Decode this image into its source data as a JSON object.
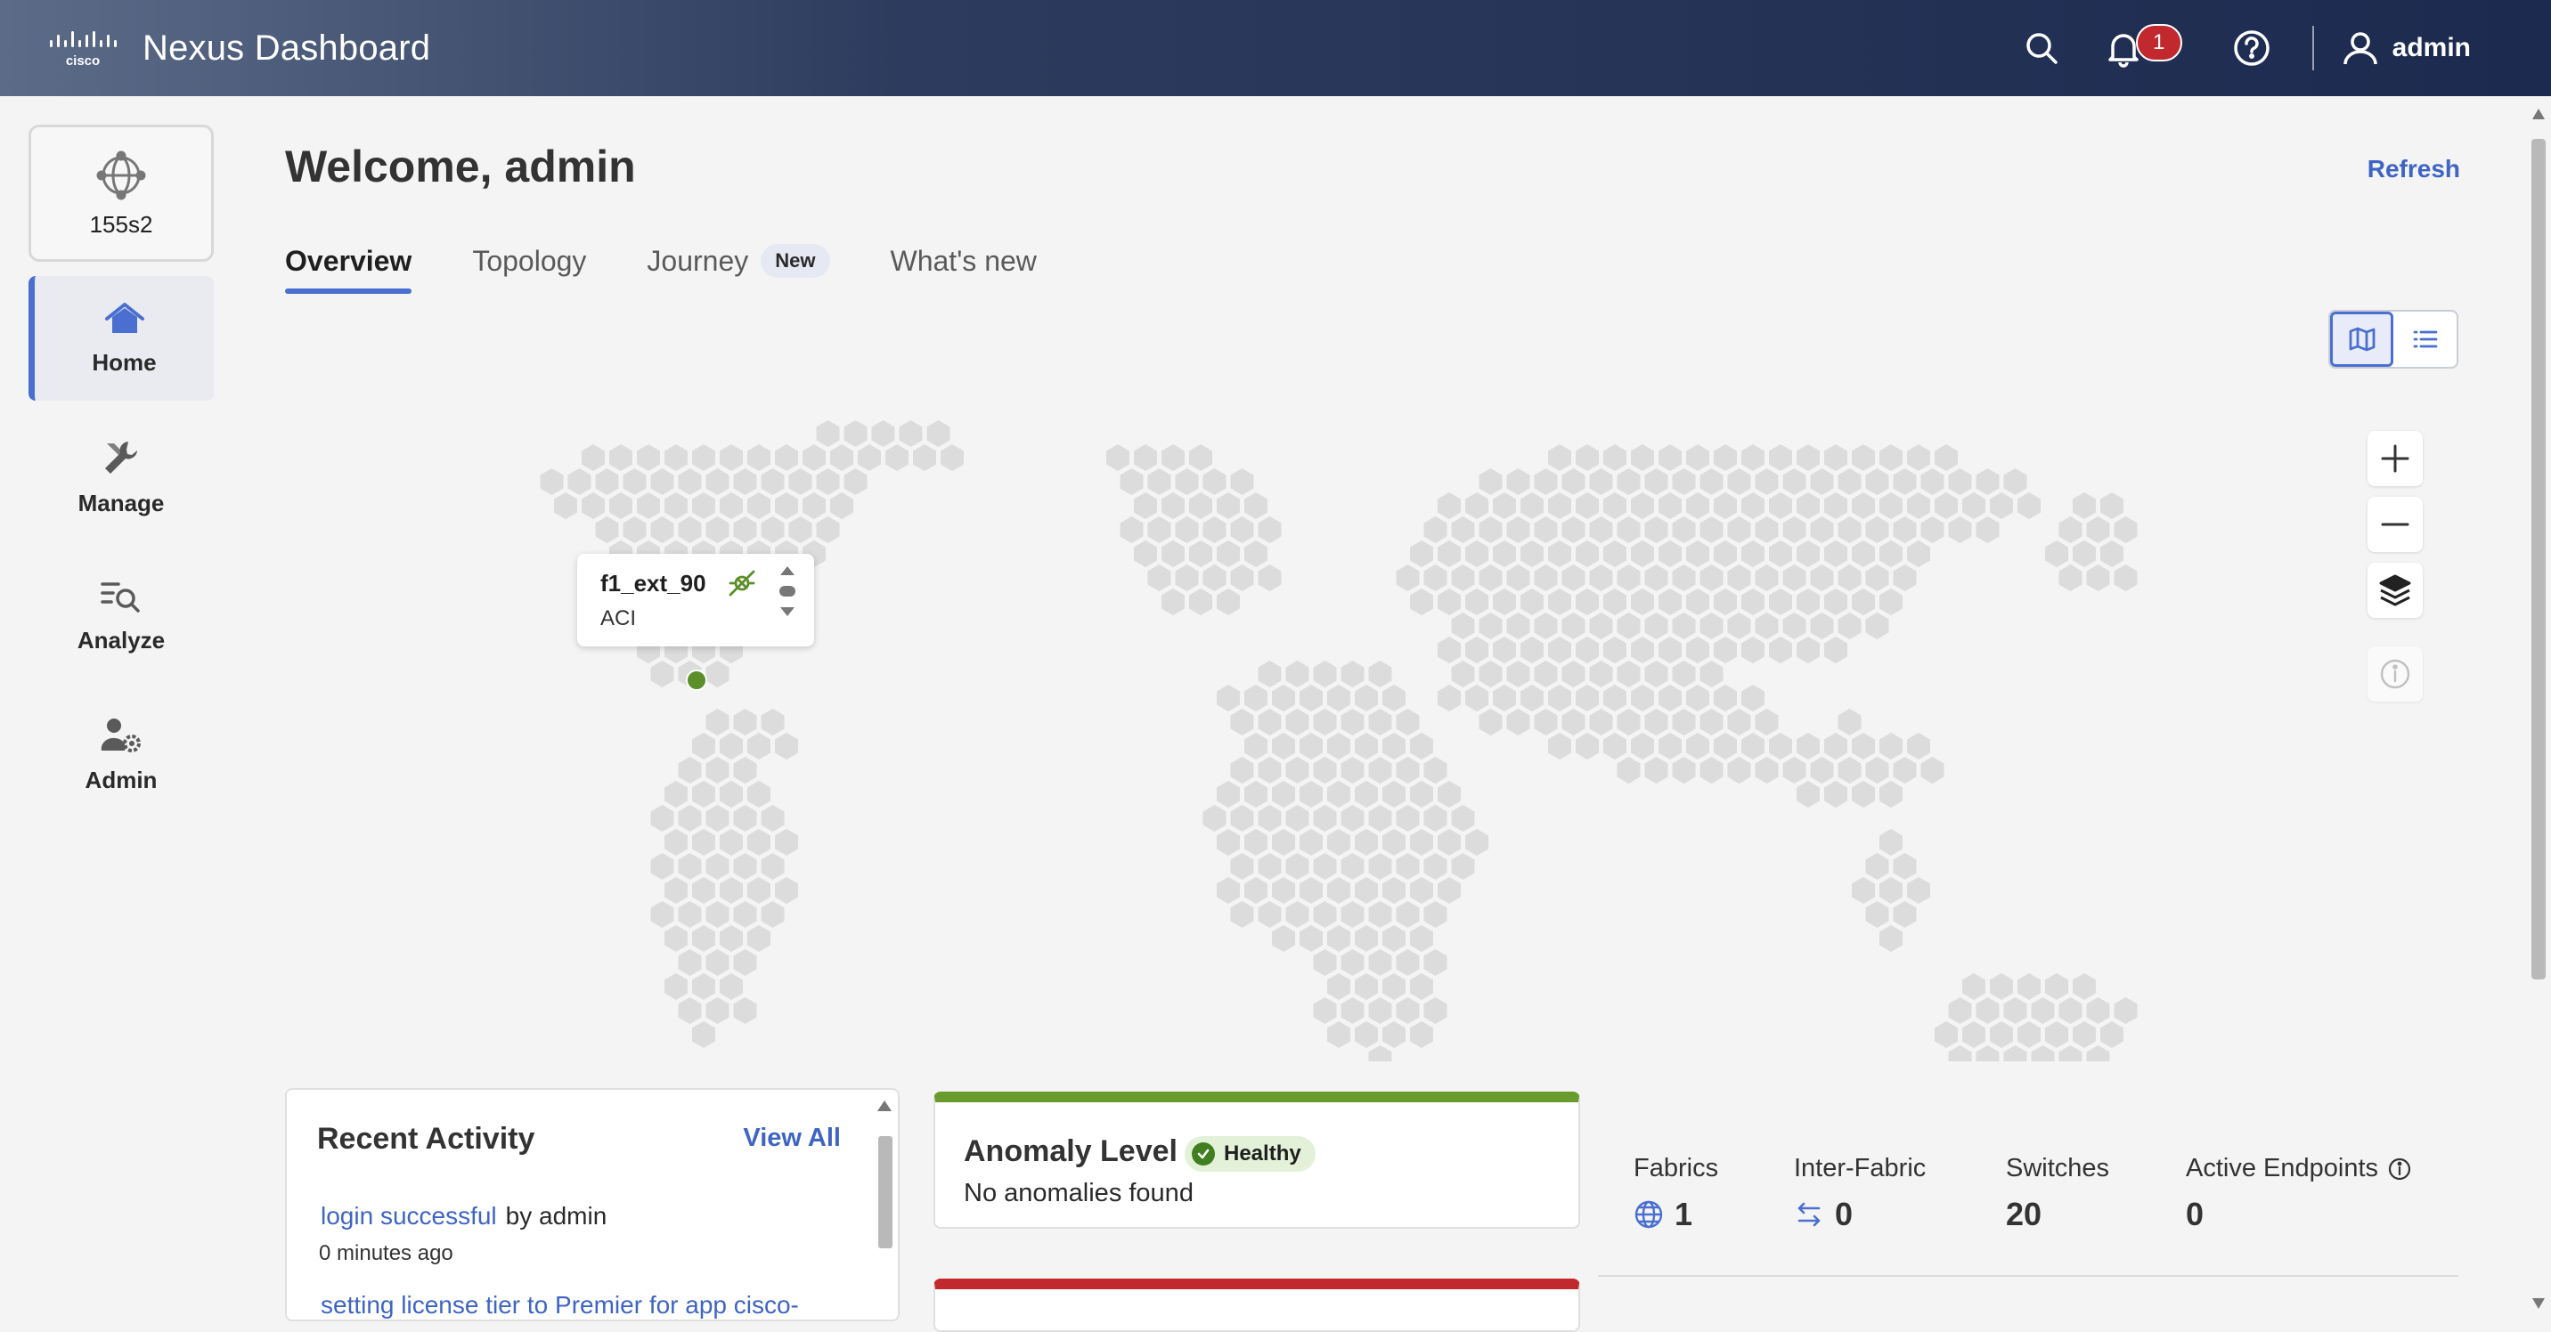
{
  "header": {
    "brand_name": "Nexus Dashboard",
    "logo_text": "cisco",
    "notification_count": "1",
    "user_name": "admin"
  },
  "sidebar": {
    "site_label": "155s2",
    "items": [
      {
        "label": "Home",
        "icon": "home-icon",
        "active": true
      },
      {
        "label": "Manage",
        "icon": "wrench-icon",
        "active": false
      },
      {
        "label": "Analyze",
        "icon": "analyze-icon",
        "active": false
      },
      {
        "label": "Admin",
        "icon": "admin-icon",
        "active": false
      }
    ]
  },
  "main": {
    "title": "Welcome, admin",
    "refresh_label": "Refresh",
    "tabs": [
      {
        "label": "Overview",
        "active": true
      },
      {
        "label": "Topology",
        "active": false
      },
      {
        "label": "Journey",
        "badge": "New",
        "active": false
      },
      {
        "label": "What's new",
        "active": false
      }
    ],
    "view_mode": "map"
  },
  "map": {
    "popup": {
      "title": "f1_ext_90",
      "subtitle": "ACI"
    },
    "marker_color": "#5a8f29"
  },
  "recent_activity": {
    "title": "Recent Activity",
    "view_all_label": "View All",
    "items": [
      {
        "text": "login successful",
        "by": "by admin",
        "time": "0 minutes ago"
      },
      {
        "text": "setting license tier to Premier for app cisco-",
        "by": "",
        "time": ""
      }
    ]
  },
  "anomaly": {
    "title": "Anomaly Level",
    "status": "Healthy",
    "message": "No anomalies found",
    "accent_color": "#6a9c2d"
  },
  "stats": {
    "fabrics": {
      "label": "Fabrics",
      "value": "1"
    },
    "inter_fabric": {
      "label": "Inter-Fabric",
      "value": "0"
    },
    "switches": {
      "label": "Switches",
      "value": "20"
    },
    "active_endpoints": {
      "label": "Active Endpoints",
      "value": "0"
    }
  },
  "colors": {
    "accent": "#4a6fd1",
    "link": "#3e64c4",
    "healthy": "#6a9c2d",
    "critical": "#c1292e"
  }
}
